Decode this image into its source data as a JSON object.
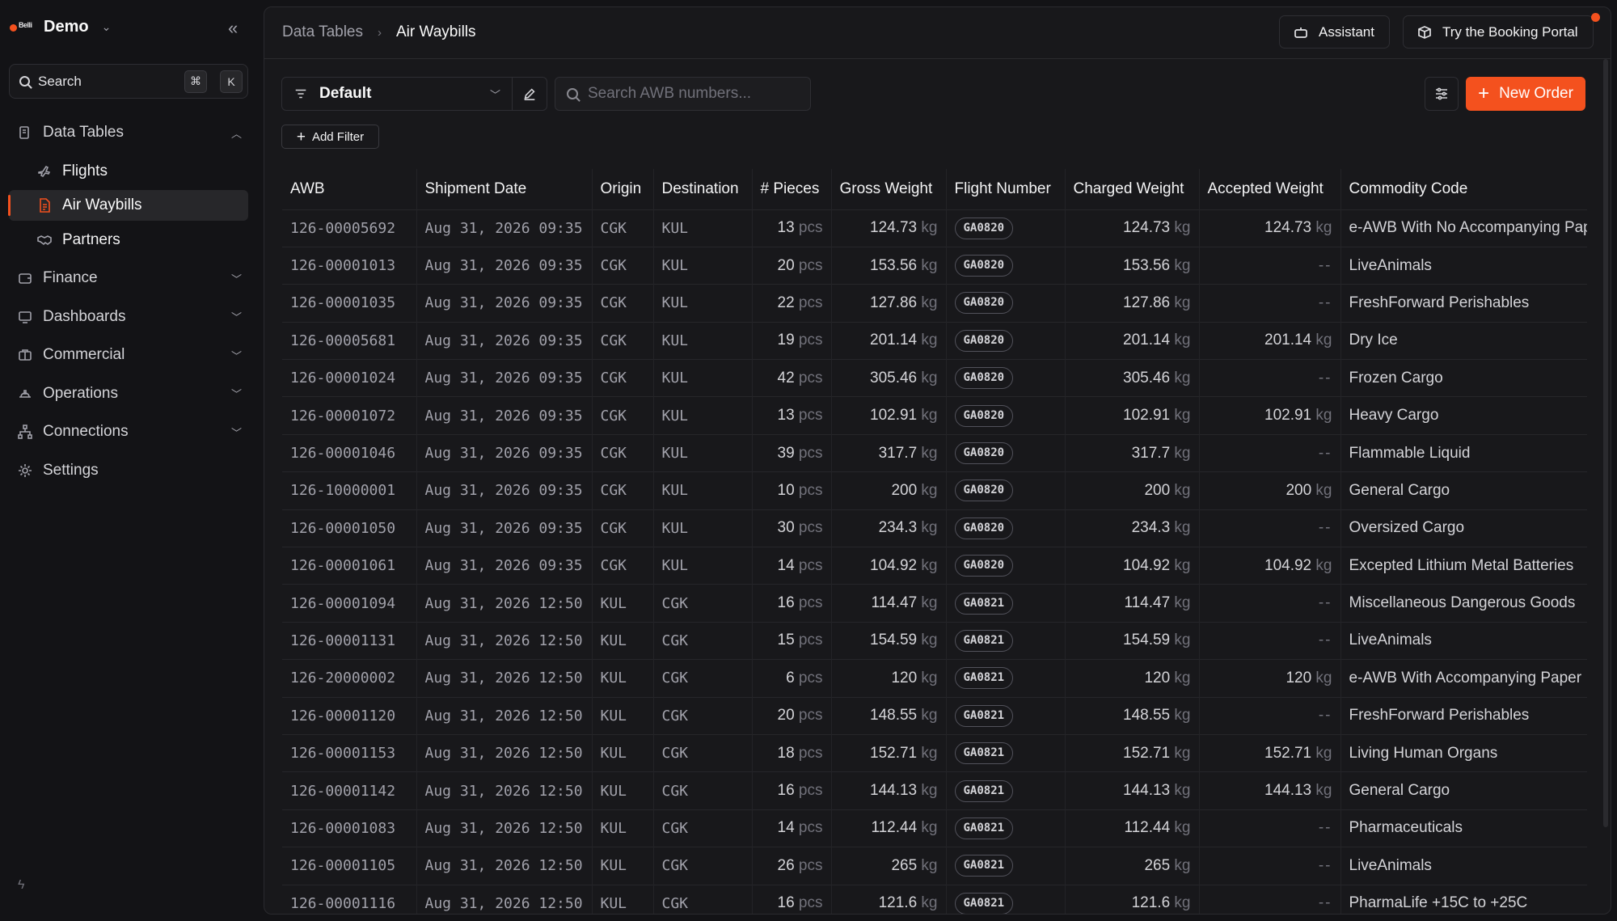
{
  "workspace": {
    "logo_text": "Belli",
    "name": "Demo"
  },
  "search": {
    "label": "Search",
    "kbd1": "⌘",
    "kbd2": "K"
  },
  "sidebar": {
    "items": [
      {
        "label": "Data Tables",
        "icon": "file-icon"
      },
      {
        "label": "Flights",
        "icon": "plane-icon"
      },
      {
        "label": "Air Waybills",
        "icon": "document-icon"
      },
      {
        "label": "Partners",
        "icon": "handshake-icon"
      },
      {
        "label": "Finance",
        "icon": "wallet-icon"
      },
      {
        "label": "Dashboards",
        "icon": "monitor-icon"
      },
      {
        "label": "Commercial",
        "icon": "briefcase-icon"
      },
      {
        "label": "Operations",
        "icon": "hardhat-icon"
      },
      {
        "label": "Connections",
        "icon": "network-icon"
      },
      {
        "label": "Settings",
        "icon": "gear-icon"
      }
    ]
  },
  "breadcrumb": {
    "parent": "Data Tables",
    "current": "Air Waybills"
  },
  "header": {
    "assistant": "Assistant",
    "booking": "Try the Booking Portal"
  },
  "toolbar": {
    "view": "Default",
    "search_placeholder": "Search AWB numbers...",
    "new_order": "New Order",
    "add_filter": "Add Filter"
  },
  "table": {
    "columns": [
      "AWB",
      "Shipment Date",
      "Origin",
      "Destination",
      "# Pieces",
      "Gross Weight",
      "Flight Number",
      "Charged Weight",
      "Accepted Weight",
      "Commodity Code"
    ],
    "pcs_unit": "pcs",
    "kg_unit": "kg",
    "rows": [
      [
        "126-00005692",
        "Aug 31, 2026 09:35",
        "CGK",
        "KUL",
        "13",
        "124.73",
        "GA0820",
        "124.73",
        "124.73",
        "e-AWB With No Accompanying Paper"
      ],
      [
        "126-00001013",
        "Aug 31, 2026 09:35",
        "CGK",
        "KUL",
        "20",
        "153.56",
        "GA0820",
        "153.56",
        "--",
        "LiveAnimals"
      ],
      [
        "126-00001035",
        "Aug 31, 2026 09:35",
        "CGK",
        "KUL",
        "22",
        "127.86",
        "GA0820",
        "127.86",
        "--",
        "FreshForward Perishables"
      ],
      [
        "126-00005681",
        "Aug 31, 2026 09:35",
        "CGK",
        "KUL",
        "19",
        "201.14",
        "GA0820",
        "201.14",
        "201.14",
        "Dry Ice"
      ],
      [
        "126-00001024",
        "Aug 31, 2026 09:35",
        "CGK",
        "KUL",
        "42",
        "305.46",
        "GA0820",
        "305.46",
        "--",
        "Frozen Cargo"
      ],
      [
        "126-00001072",
        "Aug 31, 2026 09:35",
        "CGK",
        "KUL",
        "13",
        "102.91",
        "GA0820",
        "102.91",
        "102.91",
        "Heavy Cargo"
      ],
      [
        "126-00001046",
        "Aug 31, 2026 09:35",
        "CGK",
        "KUL",
        "39",
        "317.7",
        "GA0820",
        "317.7",
        "--",
        "Flammable Liquid"
      ],
      [
        "126-10000001",
        "Aug 31, 2026 09:35",
        "CGK",
        "KUL",
        "10",
        "200",
        "GA0820",
        "200",
        "200",
        "General Cargo"
      ],
      [
        "126-00001050",
        "Aug 31, 2026 09:35",
        "CGK",
        "KUL",
        "30",
        "234.3",
        "GA0820",
        "234.3",
        "--",
        "Oversized Cargo"
      ],
      [
        "126-00001061",
        "Aug 31, 2026 09:35",
        "CGK",
        "KUL",
        "14",
        "104.92",
        "GA0820",
        "104.92",
        "104.92",
        "Excepted Lithium Metal Batteries"
      ],
      [
        "126-00001094",
        "Aug 31, 2026 12:50",
        "KUL",
        "CGK",
        "16",
        "114.47",
        "GA0821",
        "114.47",
        "--",
        "Miscellaneous Dangerous Goods"
      ],
      [
        "126-00001131",
        "Aug 31, 2026 12:50",
        "KUL",
        "CGK",
        "15",
        "154.59",
        "GA0821",
        "154.59",
        "--",
        "LiveAnimals"
      ],
      [
        "126-20000002",
        "Aug 31, 2026 12:50",
        "KUL",
        "CGK",
        "6",
        "120",
        "GA0821",
        "120",
        "120",
        "e-AWB With Accompanying Paper"
      ],
      [
        "126-00001120",
        "Aug 31, 2026 12:50",
        "KUL",
        "CGK",
        "20",
        "148.55",
        "GA0821",
        "148.55",
        "--",
        "FreshForward Perishables"
      ],
      [
        "126-00001153",
        "Aug 31, 2026 12:50",
        "KUL",
        "CGK",
        "18",
        "152.71",
        "GA0821",
        "152.71",
        "152.71",
        "Living Human Organs"
      ],
      [
        "126-00001142",
        "Aug 31, 2026 12:50",
        "KUL",
        "CGK",
        "16",
        "144.13",
        "GA0821",
        "144.13",
        "144.13",
        "General Cargo"
      ],
      [
        "126-00001083",
        "Aug 31, 2026 12:50",
        "KUL",
        "CGK",
        "14",
        "112.44",
        "GA0821",
        "112.44",
        "--",
        "Pharmaceuticals"
      ],
      [
        "126-00001105",
        "Aug 31, 2026 12:50",
        "KUL",
        "CGK",
        "26",
        "265",
        "GA0821",
        "265",
        "--",
        "LiveAnimals"
      ],
      [
        "126-00001116",
        "Aug 31, 2026 12:50",
        "KUL",
        "CGK",
        "16",
        "121.6",
        "GA0821",
        "121.6",
        "--",
        "PharmaLife +15C to +25C"
      ]
    ]
  },
  "colors": {
    "accent": "#f4511e",
    "background": "#131316",
    "panel": "#18181b"
  }
}
